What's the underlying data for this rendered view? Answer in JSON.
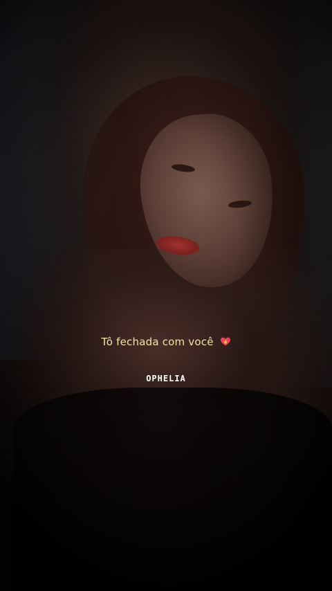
{
  "photo": {
    "caption": "Tô fechada com você",
    "caption_emoji_icon": "flaming-heart-icon",
    "watermark": "OPHELIA"
  },
  "colors": {
    "caption_text": "#f4e2a6",
    "watermark_text": "#ffffff",
    "heart": "#e8455a"
  }
}
